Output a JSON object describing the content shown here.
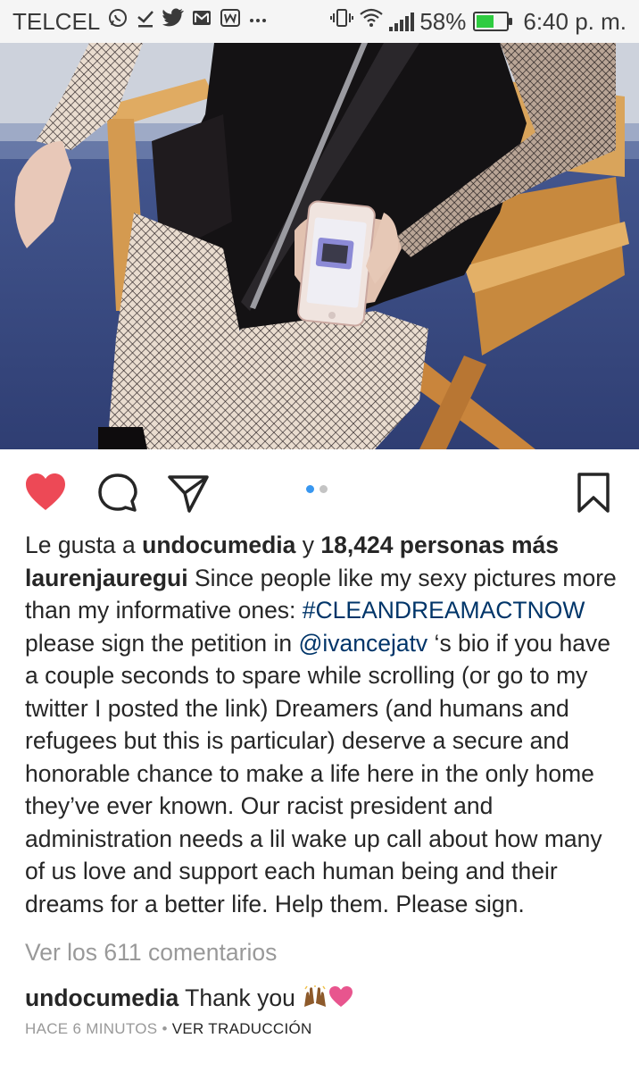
{
  "status_bar": {
    "carrier": "TELCEL",
    "notification_icons": [
      "whatsapp-icon",
      "download-done-icon",
      "twitter-icon",
      "gmail-icon",
      "wattpad-icon",
      "more-icon"
    ],
    "battery": "58%",
    "battery_level": 0.58,
    "time": "6:40 p. m."
  },
  "post": {
    "photo_alt": "",
    "carousel": {
      "total": 2,
      "active_index": 0
    },
    "likes": {
      "prefix": "Le gusta a ",
      "user": "undocumedia",
      "connector": " y ",
      "others": "18,424 personas más"
    },
    "caption": {
      "author": "laurenjauregui",
      "text_1": " Since people like my sexy pictures more than my informative ones: ",
      "hashtag": "#CLEANDREAMACTNOW",
      "text_2": " please sign the petition in ",
      "mention": "@ivancejatv",
      "text_3": " ‘s bio if you have a couple seconds to spare while scrolling (or go to my twitter I posted the link) Dreamers (and humans and refugees but this is particular) deserve a secure and honorable chance to make a life here in the only home they’ve ever known. Our racist president and administration needs a lil wake up call about how many of us love and support each human being and their dreams for a better life. Help them. Please sign."
    },
    "view_comments": "Ver los 611 comentarios",
    "comment": {
      "author": "undocumedia",
      "text": " Thank you ",
      "emojis": [
        "raising-hands-emoji",
        "pink-heart-emoji"
      ]
    },
    "meta": {
      "time_ago": "HACE 6 MINUTOS",
      "separator": " • ",
      "translate": "VER TRADUCCIÓN"
    },
    "colors": {
      "like_red": "#ed4956",
      "link_blue": "#003569",
      "carousel_active": "#3897f0",
      "muted_gray": "#999999"
    }
  }
}
